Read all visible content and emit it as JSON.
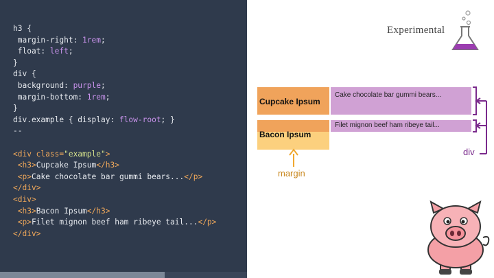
{
  "code": {
    "css_lines": [
      {
        "sel": "h3 {"
      },
      {
        "prop": "margin-right",
        "val": "1rem"
      },
      {
        "prop": "float",
        "val": "left"
      },
      {
        "sel": "}"
      },
      {
        "sel": "div {"
      },
      {
        "prop": "background",
        "val": "purple"
      },
      {
        "prop": "margin-bottom",
        "val": "1rem"
      },
      {
        "sel": "}"
      },
      {
        "rule": "div.example { display: flow-root; }"
      }
    ],
    "separator": "--",
    "html_lines": [
      {
        "indent": 0,
        "open": "<div class=",
        "attr": "\"example\"",
        "close": ">",
        "text": ""
      },
      {
        "indent": 1,
        "open": "<h3>",
        "text": "Cupcake Ipsum",
        "end": "</h3>"
      },
      {
        "indent": 1,
        "open": "<p>",
        "text": "Cake chocolate bar gummi bears...",
        "end": "</p>"
      },
      {
        "indent": 0,
        "open": "</div>",
        "text": ""
      },
      {
        "indent": 0,
        "open": "<div>",
        "text": ""
      },
      {
        "indent": 1,
        "open": "<h3>",
        "text": "Bacon Ipsum",
        "end": "</h3>"
      },
      {
        "indent": 1,
        "open": "<p>",
        "text": "Filet mignon beef ham ribeye tail...",
        "end": "</p>"
      },
      {
        "indent": 0,
        "open": "</div>",
        "text": ""
      }
    ]
  },
  "diagram": {
    "title": "Experimental",
    "h3_1": "Cupcake Ipsum",
    "p_1": "Cake chocolate bar gummi bears...",
    "h3_2": "Bacon Ipsum",
    "p_2": "Filet mignon beef ham ribeye tail...",
    "margin_label": "margin",
    "div_label": "div"
  },
  "colors": {
    "panel_bg": "#2f3a4c",
    "h3_box": "#f0a35b",
    "p_box": "#d0a1d4",
    "margin_box": "#fcd07e",
    "margin_arrow": "#f0a830",
    "div_bracket": "#7a2a8c"
  },
  "icons": {
    "flask": "flask-icon",
    "pig": "pig-illustration"
  }
}
